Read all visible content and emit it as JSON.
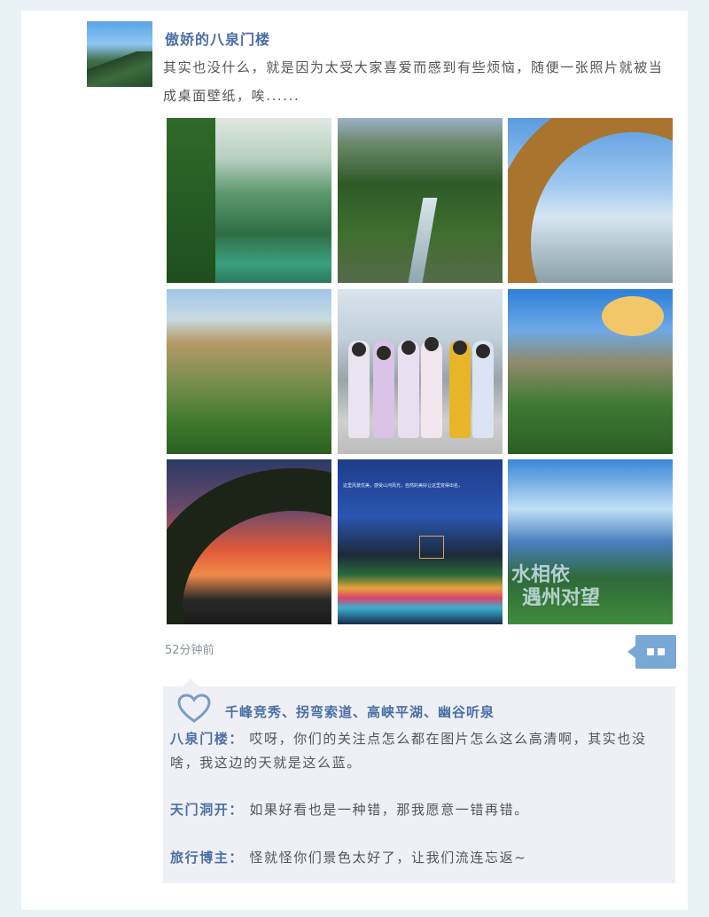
{
  "post": {
    "author": "傲娇的八泉门楼",
    "text": "其实也没什么，就是因为太受大家喜爱而感到有些烦恼，随便一张照片就被当成桌面壁纸，唉......",
    "timestamp": "52分钟前"
  },
  "photos": [
    {
      "label": "photo-1"
    },
    {
      "label": "photo-2"
    },
    {
      "label": "photo-3"
    },
    {
      "label": "photo-4"
    },
    {
      "label": "photo-5"
    },
    {
      "label": "photo-6"
    },
    {
      "label": "photo-7"
    },
    {
      "label": "photo-8",
      "caption": "这里风景优美，感受山河风光，自然的美好让这里变得出名，"
    },
    {
      "label": "photo-9",
      "caption_line1": "水相依",
      "caption_line2": "遇州对望"
    }
  ],
  "icons": {
    "comment": "comment-icon",
    "like": "heart-icon"
  },
  "feedback": {
    "likes": "千峰竞秀、拐弯索道、高峡平湖、幽谷听泉",
    "comments": [
      {
        "name": "八泉门楼",
        "separator": "：",
        "text": "哎呀，你们的关注点怎么都在图片怎么这么高清啊，其实也没啥，我这边的天就是这么蓝。"
      },
      {
        "name": "天门洞开",
        "separator": "：",
        "text": "如果好看也是一种错，那我愿意一错再错。"
      },
      {
        "name": "旅行博主",
        "separator": "：",
        "text": "怪就怪你们景色太好了，让我们流连忘返~"
      }
    ]
  },
  "colors": {
    "accent": "#4a6fa5",
    "button": "#7aa8d4",
    "background": "#e9f2f6",
    "feedback_bg": "#eef0f6"
  }
}
